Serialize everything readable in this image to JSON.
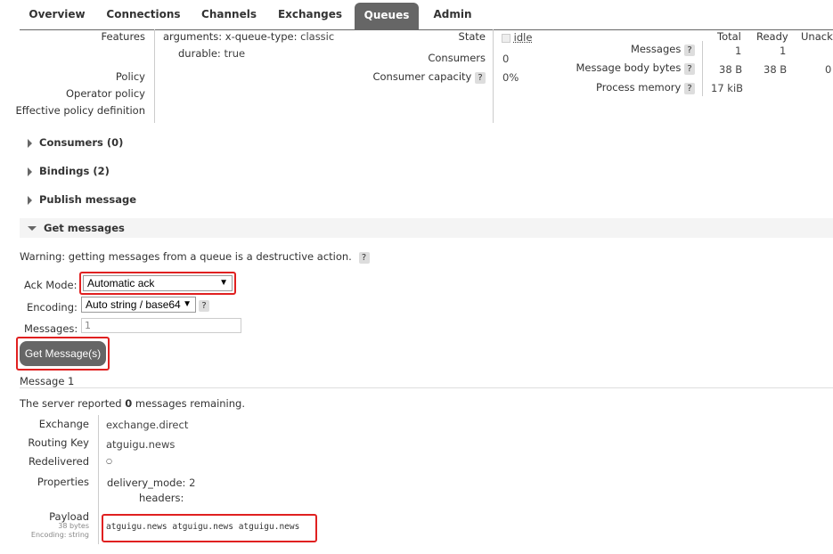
{
  "nav": {
    "tabs": [
      "Overview",
      "Connections",
      "Channels",
      "Exchanges",
      "Queues",
      "Admin"
    ],
    "active": "Queues"
  },
  "details": {
    "features_label": "Features",
    "feature_args_key": "arguments:",
    "feature_args_value_key": "x-queue-type:",
    "feature_args_value": "classic",
    "feature_durable_key": "durable:",
    "feature_durable_value": "true",
    "policy_label": "Policy",
    "operator_policy_label": "Operator policy",
    "effective_policy_label": "Effective policy definition",
    "state_label": "State",
    "state_value": "idle",
    "consumers_label": "Consumers",
    "consumers_value": "0",
    "consumer_capacity_label": "Consumer capacity",
    "consumer_capacity_value": "0%",
    "help_glyph": "?"
  },
  "stats": {
    "headers": [
      "Total",
      "Ready",
      "Unacked"
    ],
    "messages_label": "Messages",
    "messages_values": [
      "1",
      "1"
    ],
    "body_bytes_label": "Message body bytes",
    "body_bytes_values": [
      "38 B",
      "38 B",
      "0"
    ],
    "process_memory_label": "Process memory",
    "process_memory_value": "17 kiB"
  },
  "sections": {
    "consumers": "Consumers (0)",
    "bindings": "Bindings (2)",
    "publish": "Publish message",
    "get": "Get messages"
  },
  "get_messages": {
    "warning": "Warning: getting messages from a queue is a destructive action.",
    "ack_mode_label": "Ack Mode:",
    "ack_mode_value": "Automatic ack",
    "encoding_label": "Encoding:",
    "encoding_value": "Auto string / base64",
    "messages_label": "Messages:",
    "messages_value": "1",
    "button_label": "Get Message(s)"
  },
  "result": {
    "title": "Message 1",
    "server_text_pre": "The server reported ",
    "server_count": "0",
    "server_text_post": " messages remaining.",
    "exchange_label": "Exchange",
    "exchange_value": "exchange.direct",
    "routing_key_label": "Routing Key",
    "routing_key_value": "atguigu.news",
    "redelivered_label": "Redelivered",
    "redelivered_value": "○",
    "properties_label": "Properties",
    "prop_delivery_mode_key": "delivery_mode:",
    "prop_delivery_mode_value": "2",
    "prop_headers_key": "headers:",
    "payload_label": "Payload",
    "payload_bytes": "38 bytes",
    "payload_encoding": "Encoding: string",
    "payload_value": "atguigu.news atguigu.news atguigu.news"
  }
}
